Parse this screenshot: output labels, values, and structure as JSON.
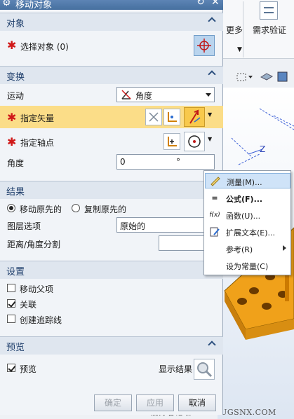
{
  "window": {
    "title": "移动对象",
    "icons": [
      "gear-icon",
      "reset-icon",
      "close-icon"
    ]
  },
  "background_app": {
    "ribbon_more_label": "更多",
    "ribbon_verify_label": "需求验证",
    "watermark": "UG爱好者论坛 WWW.UGSNX.COM",
    "axis_label": "Z"
  },
  "object_section": {
    "title": "对象",
    "select_label": "选择对象 (0)"
  },
  "transform_section": {
    "title": "变换",
    "motion_label": "运动",
    "motion_value": "角度",
    "vector_label": "指定矢量",
    "axis_point_label": "指定轴点",
    "angle_label": "角度",
    "angle_value": "0",
    "angle_unit": "°"
  },
  "result_section": {
    "title": "结果",
    "move_original": "移动原先的",
    "copy_original": "复制原先的",
    "selected_option": "移动原先的",
    "layer_option_label": "图层选项",
    "layer_option_value": "原始的",
    "distance_angle_label": "距离/角度分割"
  },
  "settings_section": {
    "title": "设置",
    "move_parent": {
      "label": "移动父项",
      "checked": false
    },
    "associative": {
      "label": "关联",
      "checked": true
    },
    "create_trace": {
      "label": "创建追踪线",
      "checked": false
    }
  },
  "preview_section": {
    "title": "预览",
    "preview": {
      "label": "预览",
      "checked": true
    },
    "show_result_label": "显示结果"
  },
  "footer": {
    "ok_label": "确定",
    "apply_label": "应用",
    "cancel_label": "取消"
  },
  "context_menu": {
    "items": [
      {
        "label": "测量(M)...",
        "icon": "ruler-icon",
        "highlighted": true
      },
      {
        "label": "公式(F)...",
        "icon": "equals-icon",
        "bold": true
      },
      {
        "label": "函数(U)...",
        "icon": "function-icon"
      },
      {
        "label": "扩展文本(E)...",
        "icon": "edit-text-icon"
      },
      {
        "label": "参考(R)",
        "icon": "",
        "submenu": true
      },
      {
        "label": "设为常量(C)",
        "icon": ""
      }
    ],
    "function_icon_text": "f(x)",
    "equals_icon_text": "="
  },
  "colors": {
    "accent_title": "#46709f",
    "highlight": "#fbdd88",
    "required": "#d01919",
    "part_orange": "#f0a11a"
  }
}
